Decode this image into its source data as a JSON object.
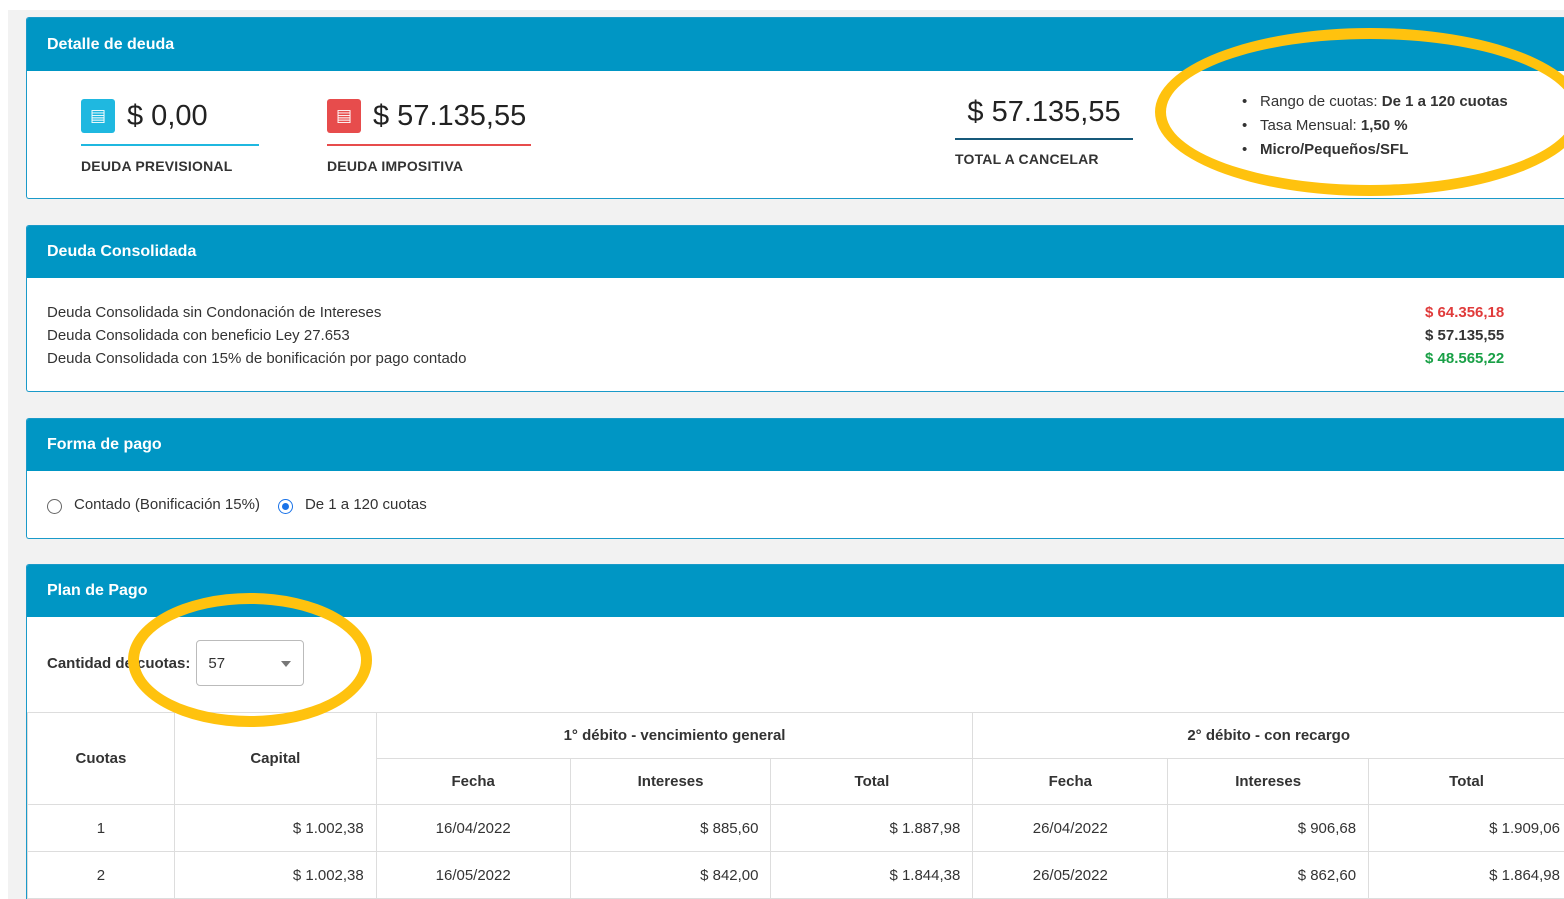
{
  "detalle": {
    "title": "Detalle de deuda",
    "previsional": {
      "amount": "$ 0,00",
      "label": "DEUDA PREVISIONAL"
    },
    "impositiva": {
      "amount": "$ 57.135,55",
      "label": "DEUDA IMPOSITIVA"
    },
    "total": {
      "amount": "$ 57.135,55",
      "label": "TOTAL A CANCELAR"
    },
    "info": {
      "rango_prefix": "Rango de cuotas: ",
      "rango_de": "De ",
      "rango_min": "1",
      "rango_a": " a ",
      "rango_max": "120",
      "rango_suffix": " cuotas",
      "tasa_prefix": "Tasa Mensual: ",
      "tasa_value": "1,50 %",
      "categoria": "Micro/Pequeños/SFL"
    }
  },
  "consolidada": {
    "title": "Deuda Consolidada",
    "rows": [
      {
        "label": "Deuda Consolidada sin Condonación de Intereses",
        "value": "$ 64.356,18",
        "color": "#e03b3b"
      },
      {
        "label": "Deuda Consolidada con beneficio Ley 27.653",
        "value": "$ 57.135,55",
        "color": "#333333"
      },
      {
        "label": "Deuda Consolidada con 15% de bonificación por pago contado",
        "value": "$ 48.565,22",
        "color": "#19a046"
      }
    ]
  },
  "forma_pago": {
    "title": "Forma de pago",
    "opcion_contado": "Contado (Bonificación 15%)",
    "opcion_cuotas": "De 1 a 120 cuotas",
    "selected": "cuotas"
  },
  "plan": {
    "title": "Plan de Pago",
    "cantidad_label": "Cantidad de cuotas:",
    "cantidad_value": "57",
    "headers": {
      "cuotas": "Cuotas",
      "capital": "Capital",
      "debito1": "1° débito - vencimiento general",
      "debito2": "2° débito - con recargo",
      "fecha": "Fecha",
      "intereses": "Intereses",
      "total": "Total"
    },
    "rows": [
      {
        "cuota": "1",
        "capital": "$ 1.002,38",
        "fecha1": "16/04/2022",
        "int1": "$ 885,60",
        "tot1": "$ 1.887,98",
        "fecha2": "26/04/2022",
        "int2": "$ 906,68",
        "tot2": "$ 1.909,06"
      },
      {
        "cuota": "2",
        "capital": "$ 1.002,38",
        "fecha1": "16/05/2022",
        "int1": "$ 842,00",
        "tot1": "$ 1.844,38",
        "fecha2": "26/05/2022",
        "int2": "$ 862,60",
        "tot2": "$ 1.864,98"
      }
    ]
  },
  "colors": {
    "header_blue": "#0096c4",
    "highlight": "#ffc20e",
    "teal_icon": "#1fb8e0",
    "red_icon": "#e74c4c"
  },
  "icons": [
    "document-icon",
    "chevron-down-icon"
  ]
}
